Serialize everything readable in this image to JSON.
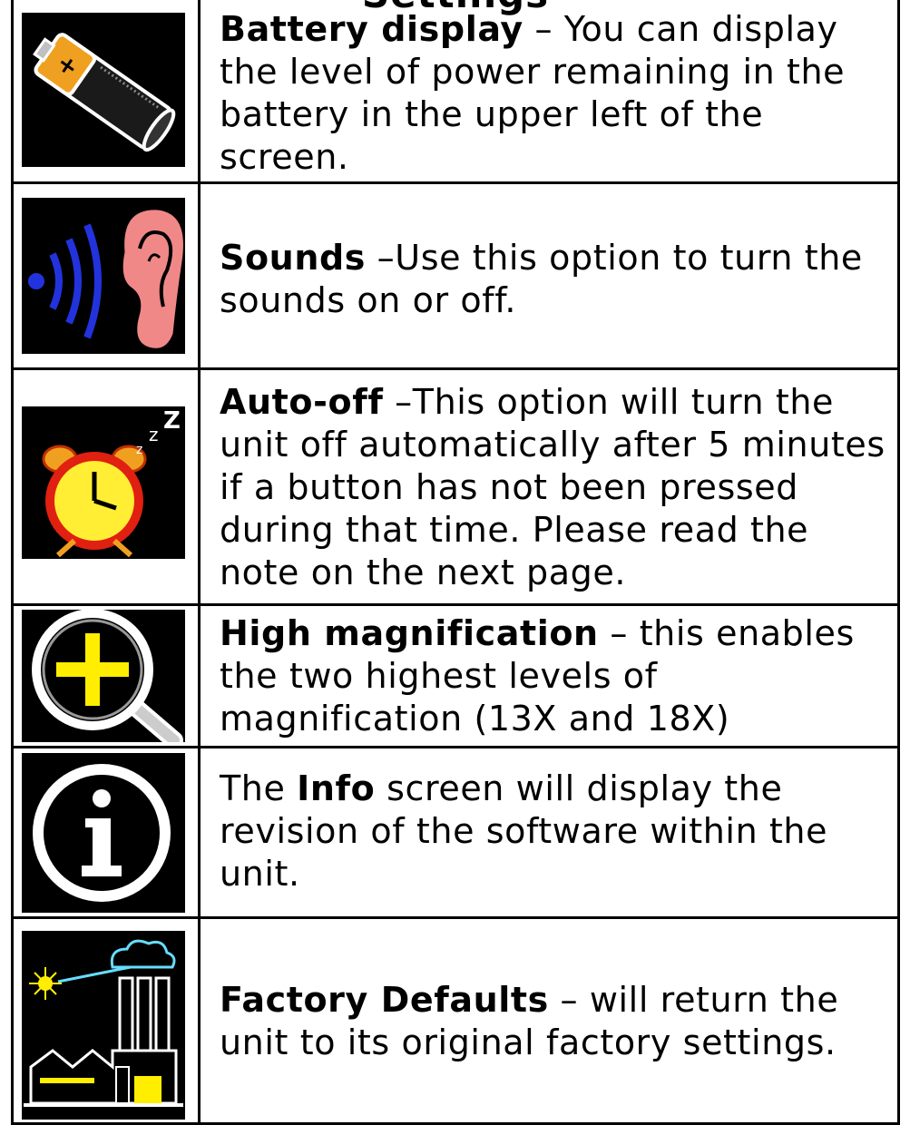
{
  "heading_fragment": "Settings",
  "rows": [
    {
      "icon": "battery-icon",
      "term": "Battery display",
      "sep": " – ",
      "desc": "You can display the level of power remaining in the battery in the upper left of the screen."
    },
    {
      "icon": "ear-sound-icon",
      "term": "Sounds",
      "sep": " –",
      "desc": "Use this option to turn the sounds on or off."
    },
    {
      "icon": "alarm-clock-icon",
      "term": "Auto-off",
      "sep": " –",
      "desc": "This option will turn the unit off automatically after 5 minutes if a button has not been pressed during that time.  Please read the note on the next page."
    },
    {
      "icon": "magnifier-plus-icon",
      "term": "High magnification",
      "sep": " – ",
      "desc": "this enables the two highest levels of magnification (13X and 18X)"
    },
    {
      "icon": "info-icon",
      "prefix": "The ",
      "term": "Info",
      "desc": " screen will display the revision of the software within the unit."
    },
    {
      "icon": "factory-icon",
      "term": "Factory Defaults",
      "sep": " – ",
      "desc": "will return the unit to its original factory settings."
    }
  ]
}
